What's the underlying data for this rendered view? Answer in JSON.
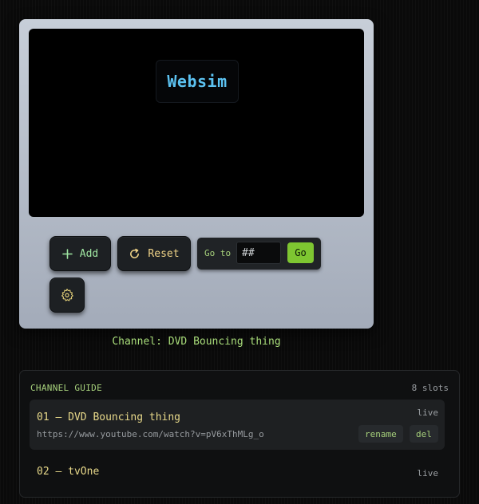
{
  "player": {
    "logo_text": "Websim",
    "add_label": "Add",
    "reset_label": "Reset",
    "goto_label": "Go to",
    "goto_placeholder": "##",
    "go_label": "Go",
    "channel_label": "Channel: DVD Bouncing thing"
  },
  "guide": {
    "title": "CHANNEL GUIDE",
    "count": "8 slots",
    "items": [
      {
        "title": "01 — DVD Bouncing thing",
        "url": "https://www.youtube.com/watch?v=pV6xThMLg_o",
        "status": "live",
        "rename_label": "rename",
        "del_label": "del"
      },
      {
        "title": "02 — tvOne",
        "status": "live"
      }
    ]
  },
  "icons": {
    "add": "plus-icon",
    "reset": "refresh-icon",
    "settings": "gear-icon"
  },
  "colors": {
    "accent_green": "#7ec631",
    "logo_blue": "#5cc2f1",
    "label_green": "#a6d07b",
    "title_yellow": "#e8d98a"
  }
}
